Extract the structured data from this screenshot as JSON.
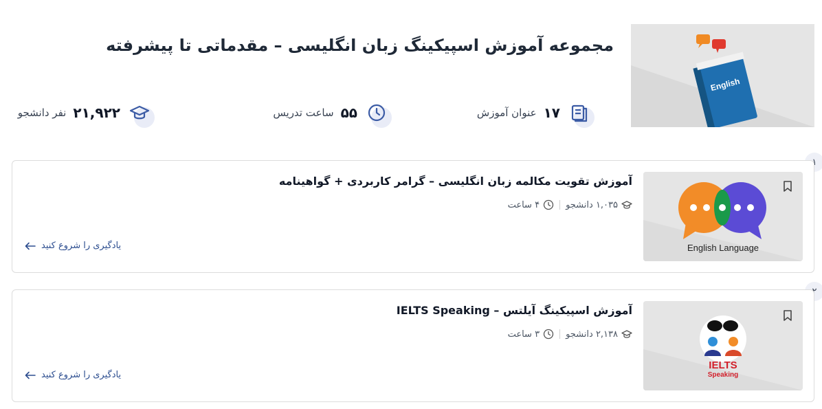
{
  "header": {
    "title": "مجموعه آموزش اسپیکینگ زبان انگلیسی – مقدماتی تا پیشرفته",
    "image_text": "English"
  },
  "stats": {
    "courses": {
      "value": "۱۷",
      "unit": "عنوان آموزش",
      "icon": "book-icon"
    },
    "hours": {
      "value": "۵۵",
      "unit": "ساعت تدریس",
      "icon": "clock-icon"
    },
    "students": {
      "value": "۲۱,۹۲۲",
      "unit": "نفر دانشجو",
      "icon": "graduation-cap-icon"
    }
  },
  "courses": [
    {
      "number": "۱",
      "title": "آموزش تقویت مکالمه زبان انگلیسی – گرامر کاربردی + گواهینامه",
      "students": "۱,۰۳۵ دانشجو",
      "duration": "۴ ساعت",
      "cta": "یادگیری را شروع کنید",
      "image_text": "English Language"
    },
    {
      "number": "۲",
      "title": "آموزش اسپیکینگ آیلتس – IELTS Speaking",
      "students": "۲,۱۳۸ دانشجو",
      "duration": "۳ ساعت",
      "cta": "یادگیری را شروع کنید",
      "image_text": "IELTS",
      "image_subtext": "Speaking"
    }
  ],
  "colors": {
    "accent": "#2c4d8f",
    "icon": "#3b5ba5",
    "border": "#dcdcdc",
    "thumb_bg": "#e5e5e5"
  }
}
